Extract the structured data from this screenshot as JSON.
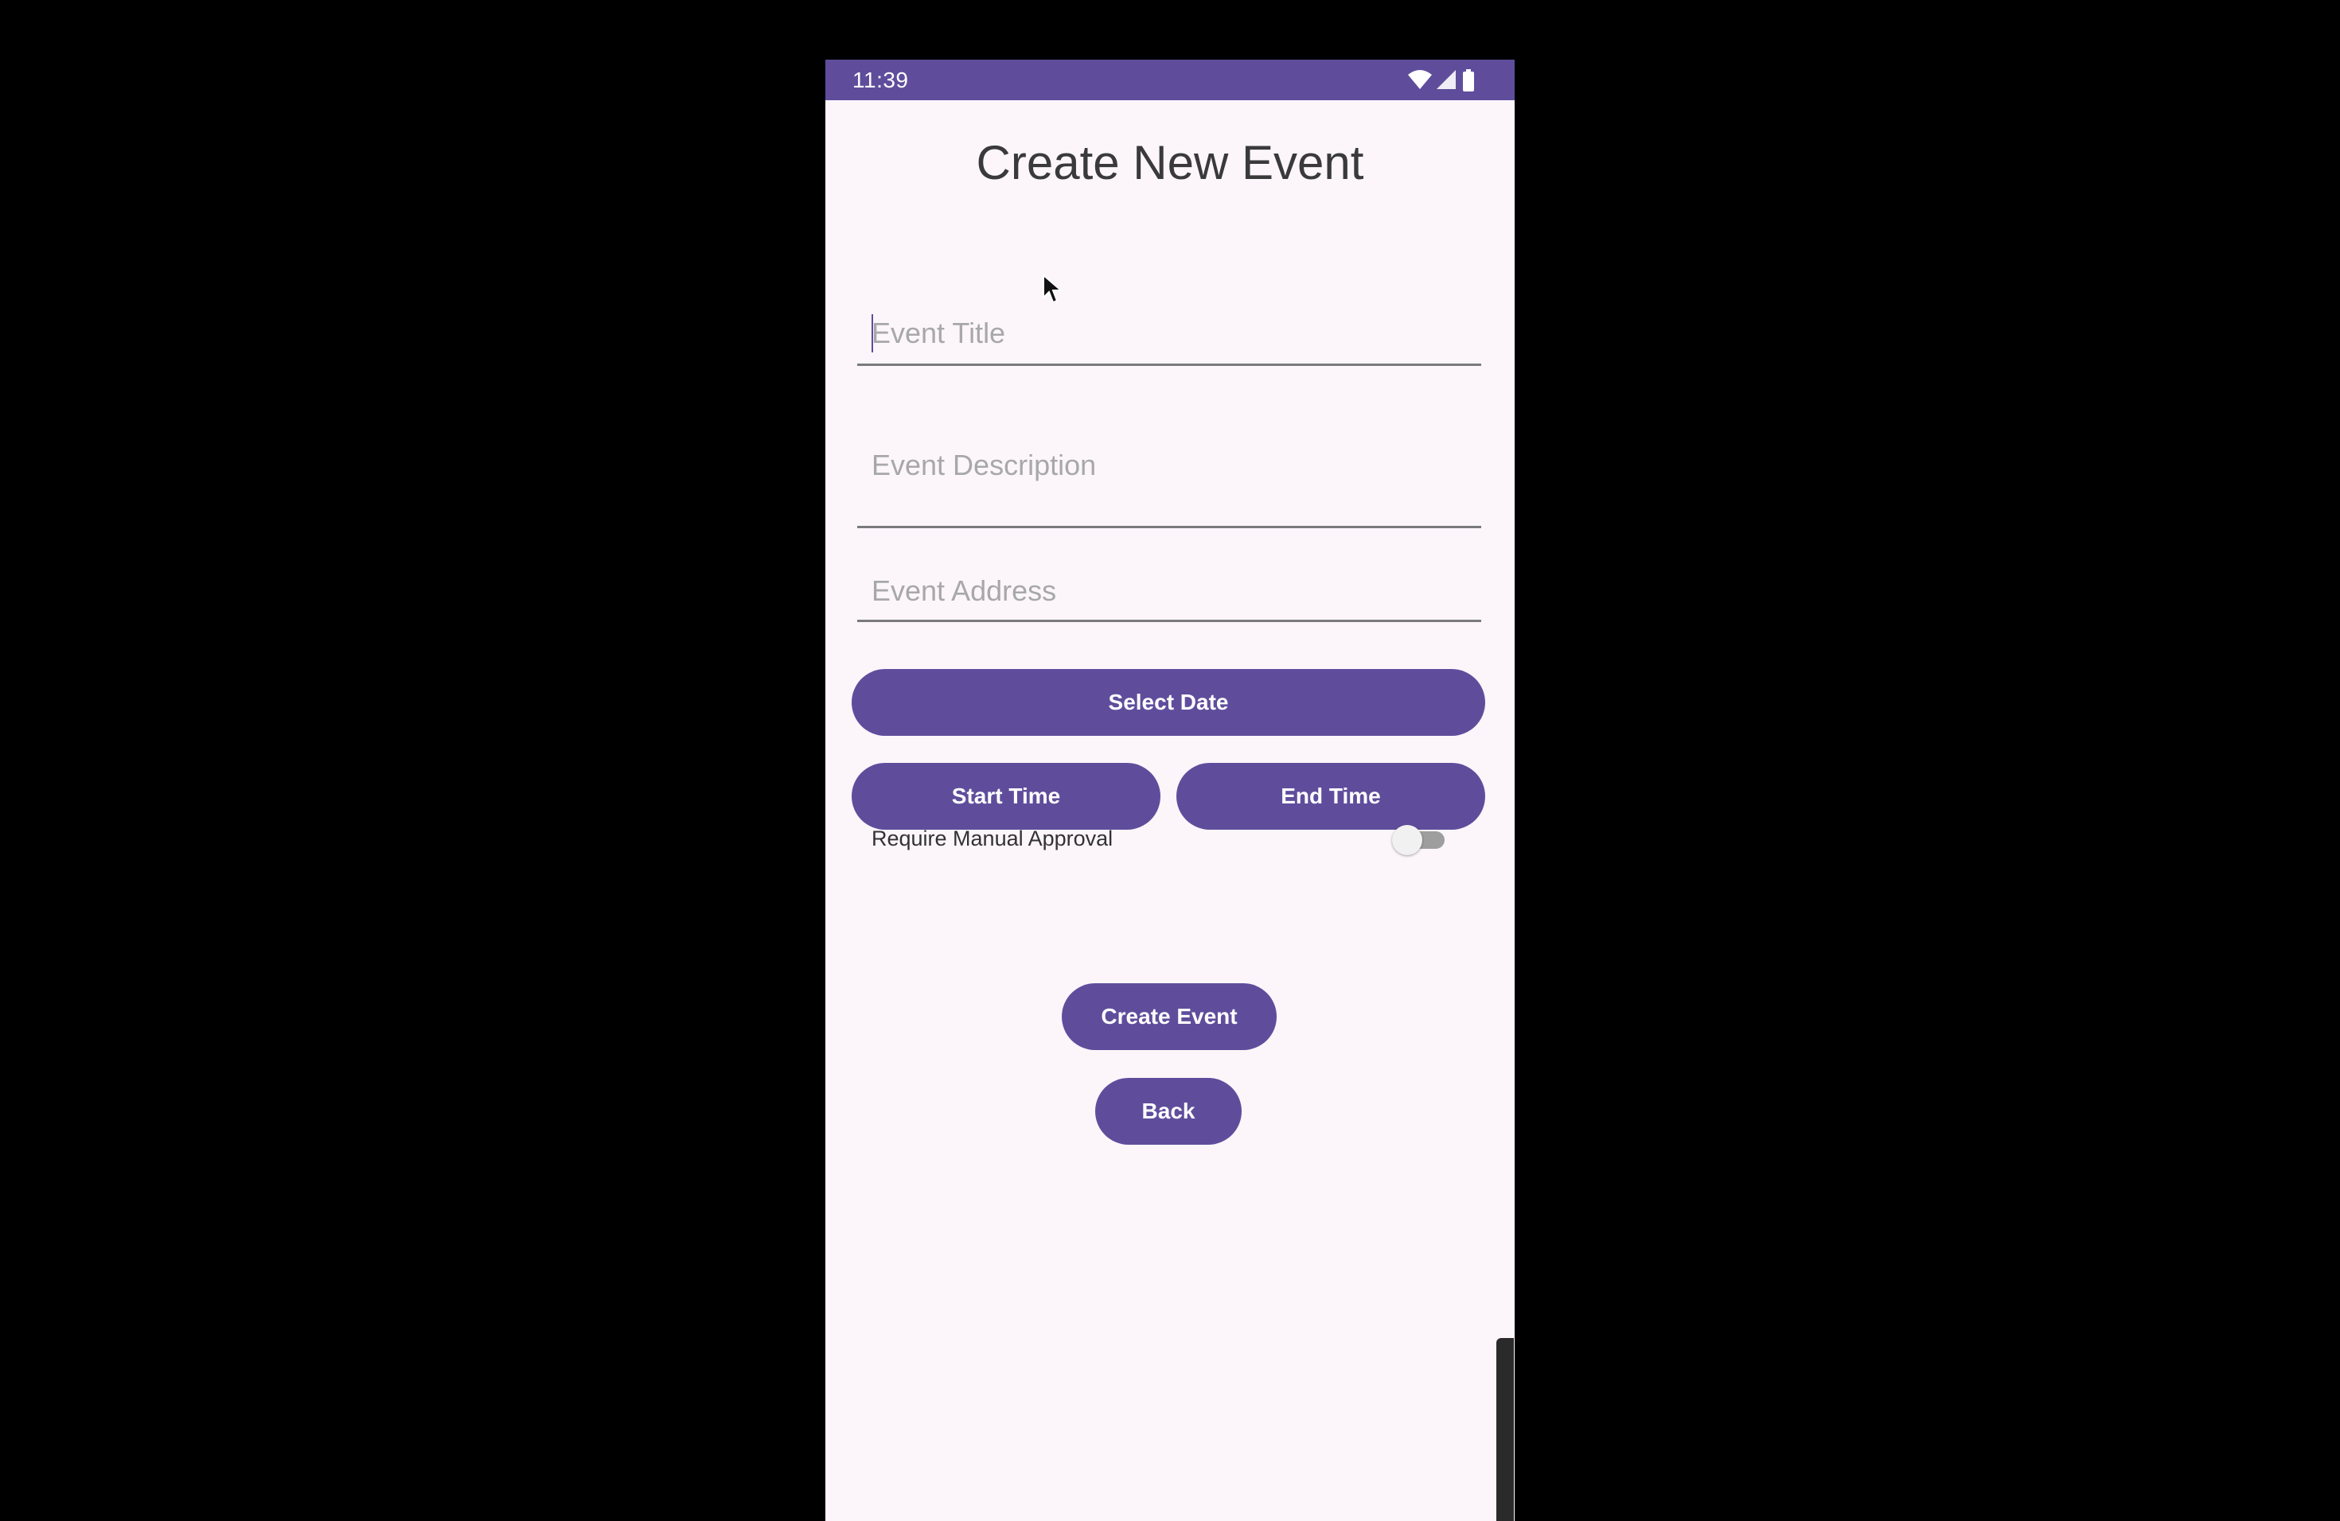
{
  "status_bar": {
    "time": "11:39",
    "icons": [
      "wifi-icon",
      "cell-signal-icon",
      "battery-icon"
    ]
  },
  "page": {
    "title": "Create New Event"
  },
  "form": {
    "event_title_placeholder": "Event Title",
    "event_title_value": "",
    "event_description_placeholder": "Event Description",
    "event_description_value": "",
    "event_address_placeholder": "Event Address",
    "event_address_value": ""
  },
  "buttons": {
    "select_date": "Select Date",
    "start_time": "Start Time",
    "end_time": "End Time",
    "create_event": "Create Event",
    "back": "Back"
  },
  "approval": {
    "label": "Require Manual Approval",
    "enabled": false
  },
  "colors": {
    "primary": "#5f4d9c",
    "background": "#fcf6fb",
    "outer": "#000000"
  }
}
